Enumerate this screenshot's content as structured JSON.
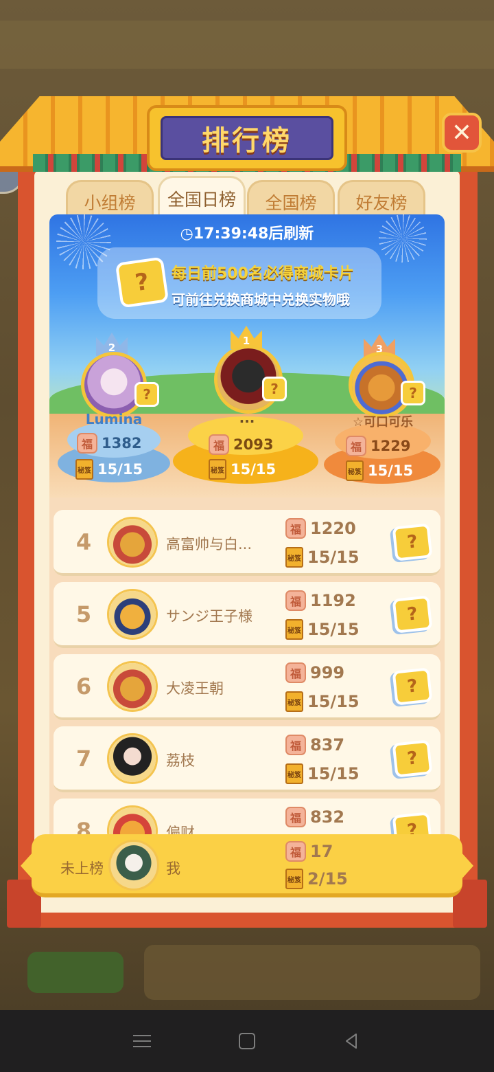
{
  "title": "排行榜",
  "close_icon": "✕",
  "tabs": [
    {
      "label": "小组榜",
      "active": false
    },
    {
      "label": "全国日榜",
      "active": true
    },
    {
      "label": "全国榜",
      "active": false
    },
    {
      "label": "好友榜",
      "active": false
    }
  ],
  "refresh_text": "◷17:39:48后刷新",
  "banner": {
    "card_icon": "?",
    "line1": "每日前500名必得商城卡片",
    "line2": "可前往兑换商城中兑换实物哦"
  },
  "podium": [
    {
      "rank": "2",
      "name": "Lumina",
      "score": "1382",
      "progress": "15/15"
    },
    {
      "rank": "1",
      "name": "...",
      "score": "2093",
      "progress": "15/15"
    },
    {
      "rank": "3",
      "name": "☆可口可乐",
      "score": "1229",
      "progress": "15/15"
    }
  ],
  "icons": {
    "fu": "福",
    "book": "秘笈",
    "card": "?"
  },
  "list": [
    {
      "rank": "4",
      "name": "高富帅与白...",
      "score": "1220",
      "progress": "15/15"
    },
    {
      "rank": "5",
      "name": "サンジ王子様",
      "score": "1192",
      "progress": "15/15"
    },
    {
      "rank": "6",
      "name": "大凌王朝",
      "score": "999",
      "progress": "15/15"
    },
    {
      "rank": "7",
      "name": "荔枝",
      "score": "837",
      "progress": "15/15"
    },
    {
      "rank": "8",
      "name": "偏财",
      "score": "832",
      "progress": ""
    }
  ],
  "me": {
    "rank_text": "未上榜",
    "name": "我",
    "score": "17",
    "progress": "2/15"
  }
}
